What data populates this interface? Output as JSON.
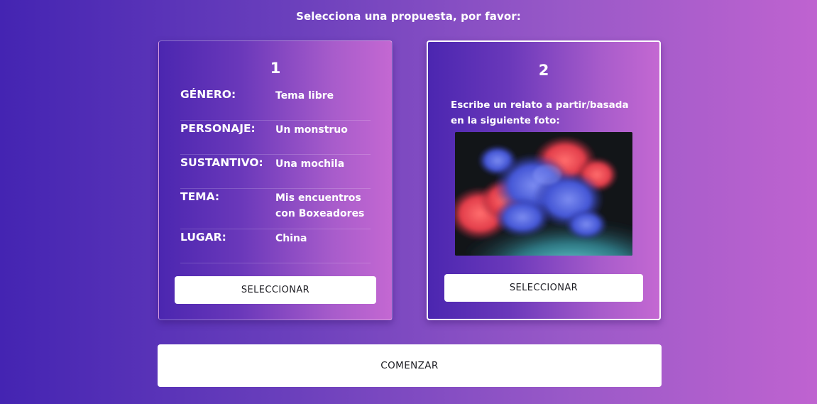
{
  "prompt": "Selecciona una propuesta, por favor:",
  "proposals": [
    {
      "number": "1",
      "rows": [
        {
          "label": "GÉNERO:",
          "value": "Tema libre"
        },
        {
          "label": "PERSONAJE:",
          "value": "Un monstruo"
        },
        {
          "label": "SUSTANTIVO:",
          "value": "Una mochila"
        },
        {
          "label": "TEMA:",
          "value": "Mis encuentros con Boxeadores"
        },
        {
          "label": "LUGAR:",
          "value": "China"
        }
      ],
      "button_label": "SELECCIONAR"
    },
    {
      "number": "2",
      "description": "Escribe un relato a partir/basada en la siguiente foto:",
      "image_subject": "colorful smoke explosion (red, blue, cyan) on black background",
      "button_label": "SELECCIONAR",
      "selected": true
    }
  ],
  "start_button_label": "COMENZAR",
  "colors": {
    "background_start": "#4424b2",
    "background_end": "#bf63d0",
    "card_start": "#4b26b0",
    "card_end": "#c468d2",
    "button_bg": "#ffffff",
    "button_text": "#1c1c22",
    "selected_border": "#ffffff"
  }
}
